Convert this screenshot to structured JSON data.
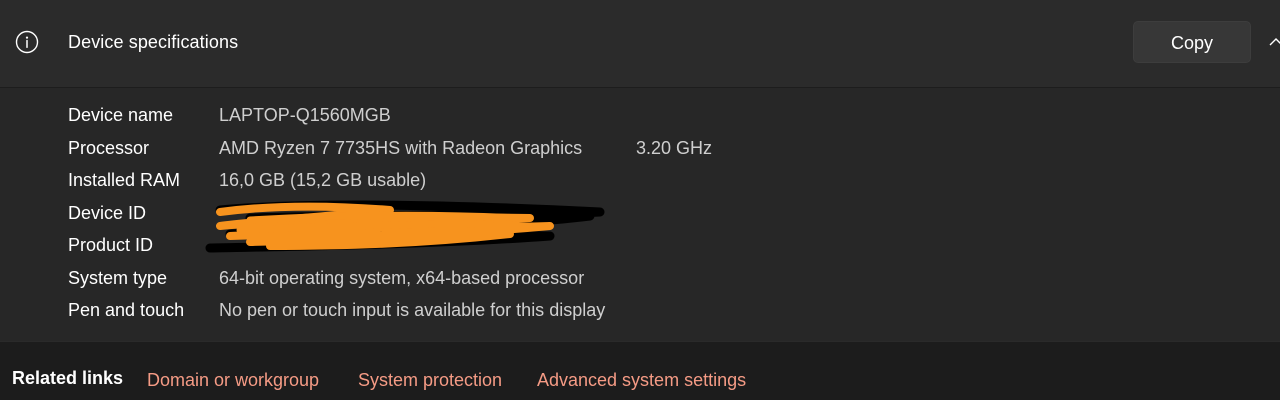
{
  "section": {
    "title": "Device specifications",
    "icon": "info-icon",
    "copy_label": "Copy",
    "expand_icon": "chevron-up-icon"
  },
  "specs": [
    {
      "label": "Device name",
      "value": "LAPTOP-Q1560MGB",
      "extra": ""
    },
    {
      "label": "Processor",
      "value": "AMD Ryzen 7 7735HS with Radeon Graphics",
      "extra": "3.20 GHz"
    },
    {
      "label": "Installed RAM",
      "value": "16,0 GB (15,2 GB usable)",
      "extra": ""
    },
    {
      "label": "Device ID",
      "value": "",
      "extra": ""
    },
    {
      "label": "Product ID",
      "value": "",
      "extra": ""
    },
    {
      "label": "System type",
      "value": "64-bit operating system, x64-based processor",
      "extra": ""
    },
    {
      "label": "Pen and touch",
      "value": "No pen or touch input is available for this display",
      "extra": ""
    }
  ],
  "related": {
    "title": "Related links",
    "links": [
      "Domain or workgroup",
      "System protection",
      "Advanced system settings"
    ]
  },
  "colors": {
    "link": "#f59b85",
    "redaction_orange": "#f7931e",
    "redaction_black": "#000000"
  }
}
